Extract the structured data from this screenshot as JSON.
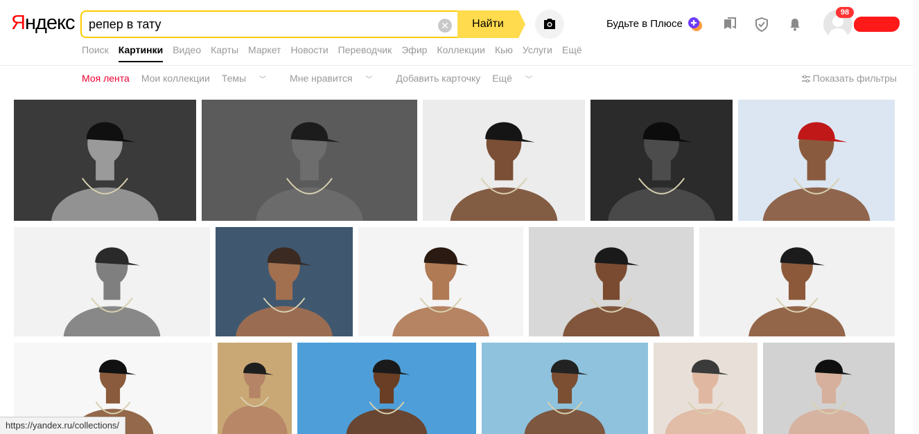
{
  "logo": {
    "first": "Я",
    "rest": "ндекс"
  },
  "search": {
    "query": "репер в тату",
    "button": "Найти"
  },
  "header": {
    "plus_label": "Будьте в Плюсе",
    "notifications_count": "98"
  },
  "services": [
    "Поиск",
    "Картинки",
    "Видео",
    "Карты",
    "Маркет",
    "Новости",
    "Переводчик",
    "Эфир",
    "Коллекции",
    "Кью",
    "Услуги",
    "Ещё"
  ],
  "subnav": {
    "feed": "Моя лента",
    "collections": "Мои коллекции",
    "themes": "Темы",
    "likes": "Мне нравится",
    "add_card": "Добавить карточку",
    "more": "Ещё",
    "filters": "Показать фильтры"
  },
  "status_bar": "https://yandex.ru/collections/",
  "colors": {
    "accent": "#ffdb4d",
    "logo_red": "#ff0000",
    "feed_red": "#ee0033"
  },
  "images": [
    {
      "bg": "#3a3a3a",
      "skin": "#9a9a9a",
      "cap": "#101010"
    },
    {
      "bg": "#5b5b5b",
      "skin": "#6d6d6d",
      "cap": "#1c1c1c"
    },
    {
      "bg": "#ececec",
      "skin": "#7a4f35",
      "cap": "#151515"
    },
    {
      "bg": "#2b2b2b",
      "skin": "#4c4c4c",
      "cap": "#0c0c0c"
    },
    {
      "bg": "#dbe6f2",
      "skin": "#8a5a3f",
      "cap": "#c01818"
    },
    {
      "bg": "#f2f2f2",
      "skin": "#7f7f7f",
      "cap": "#2a2a2a"
    },
    {
      "bg": "#3f5870",
      "skin": "#a26f4f",
      "cap": "#3b2a22"
    },
    {
      "bg": "#f4f4f4",
      "skin": "#b07a55",
      "cap": "#2a1a12"
    },
    {
      "bg": "#d8d8d8",
      "skin": "#7a4b30",
      "cap": "#1a1a1a"
    },
    {
      "bg": "#f1f1f1",
      "skin": "#8c5a3b",
      "cap": "#1b1b1b"
    },
    {
      "bg": "#f7f7f7",
      "skin": "#8a5b3c",
      "cap": "#111111"
    },
    {
      "bg": "#c9a875",
      "skin": "#b58466",
      "cap": "#1e1e1e"
    },
    {
      "bg": "#4e9fd9",
      "skin": "#6a3e24",
      "cap": "#1a1a1a"
    },
    {
      "bg": "#8fc2dd",
      "skin": "#7c4e32",
      "cap": "#222222"
    },
    {
      "bg": "#e8e0d8",
      "skin": "#e0b8a2",
      "cap": "#3a3a3a"
    },
    {
      "bg": "#d2d2d2",
      "skin": "#d6b09c",
      "cap": "#0f0f0f"
    }
  ]
}
